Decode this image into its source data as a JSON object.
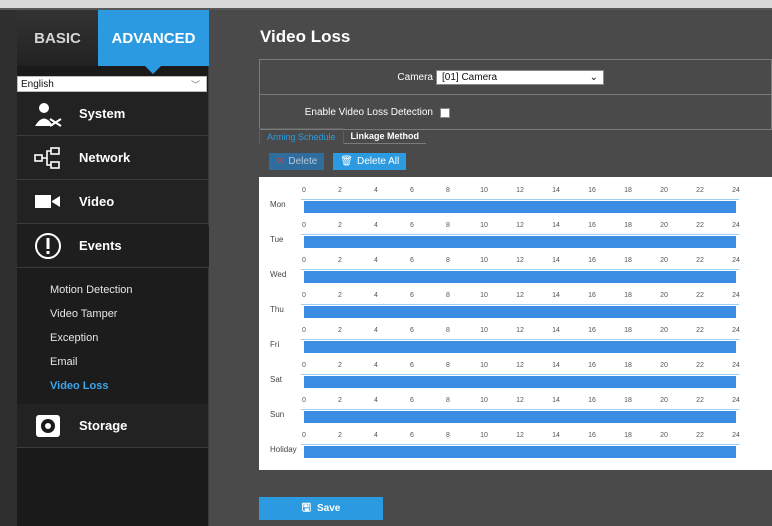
{
  "modes": {
    "basic": "BASIC",
    "advanced": "ADVANCED"
  },
  "language": {
    "value": "English"
  },
  "nav": [
    {
      "label": "System",
      "icon": "system-icon"
    },
    {
      "label": "Network",
      "icon": "network-icon"
    },
    {
      "label": "Video",
      "icon": "video-icon"
    },
    {
      "label": "Events",
      "icon": "alert-icon"
    }
  ],
  "events_sub": [
    "Motion Detection",
    "Video Tamper",
    "Exception",
    "Email",
    "Video Loss"
  ],
  "active_sub": "Video Loss",
  "storage": {
    "label": "Storage",
    "icon": "storage-icon"
  },
  "page": {
    "title": "Video Loss"
  },
  "form": {
    "camera_label": "Camera",
    "camera_value": "[01] Camera",
    "enable_label": "Enable Video Loss Detection",
    "enable_checked": false
  },
  "tabs": [
    "Arming Schedule",
    "Linkage Method"
  ],
  "buttons": {
    "delete": "Delete",
    "delete_all": "Delete All",
    "save": "Save"
  },
  "schedule": {
    "days": [
      "Mon",
      "Tue",
      "Wed",
      "Thu",
      "Fri",
      "Sat",
      "Sun",
      "Holiday"
    ],
    "hour_ticks": [
      "0",
      "2",
      "4",
      "6",
      "8",
      "10",
      "12",
      "14",
      "16",
      "18",
      "20",
      "22",
      "24"
    ],
    "armed_from": 0,
    "armed_to": 24
  },
  "colors": {
    "accent": "#2b9ae0",
    "bar": "#3a8de3",
    "sidebar": "#1a1a1a",
    "panel": "#4a4a4a"
  }
}
